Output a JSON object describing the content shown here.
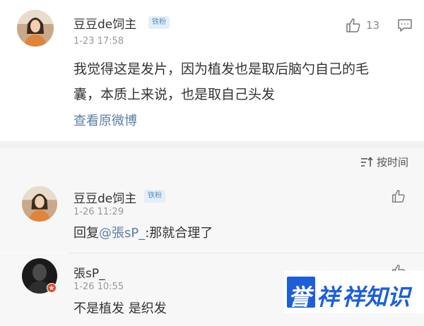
{
  "post": {
    "username": "豆豆de饲主",
    "badge": "铁粉",
    "timestamp": "1-23 17:58",
    "like_count": "13",
    "text_line1": "我觉得这是发片，因为植发也是取后脑勺自己的毛",
    "text_line2": "囊，本质上来说，也是取自己头发",
    "view_original": "查看原微博"
  },
  "sort": {
    "label": "按时间"
  },
  "replies": [
    {
      "username": "豆豆de饲主",
      "badge": "铁粉",
      "timestamp": "1-26 11:29",
      "prefix": "回复",
      "mention": "@張sP_",
      "suffix": ":那就合理了"
    },
    {
      "username": "張sP_",
      "timestamp": "1-26 10:55",
      "text": "不是植发 是织发"
    }
  ],
  "watermark": {
    "c1": "誉",
    "c2": "祥",
    "c3": "祥知识"
  },
  "colors": {
    "accent_blue": "#5b7fa7",
    "badge_bg": "#e3eef7",
    "brand_blue": "#1c5fd8"
  }
}
